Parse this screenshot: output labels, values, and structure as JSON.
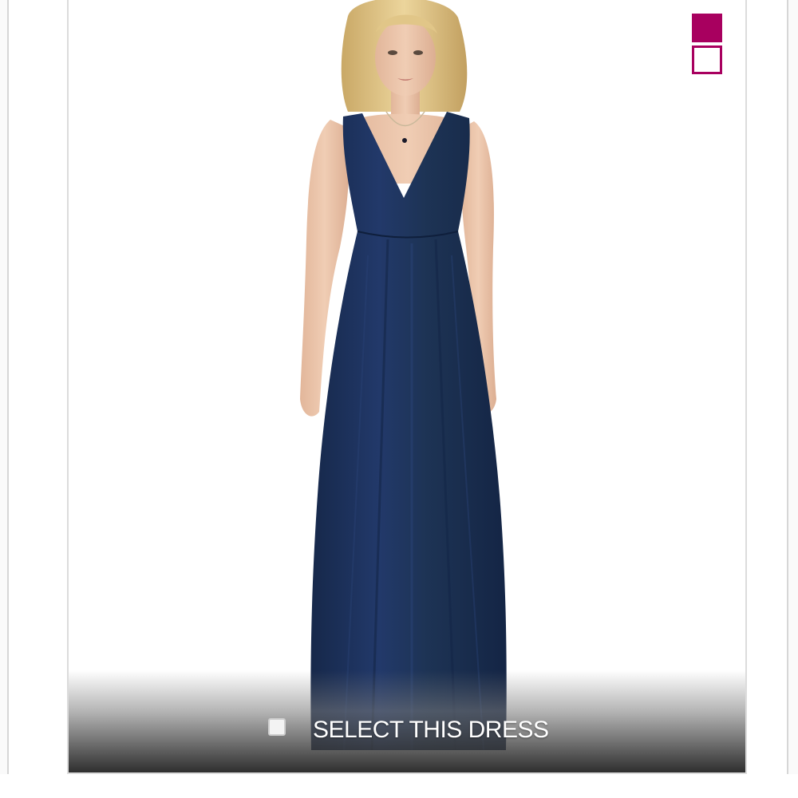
{
  "product": {
    "image": {
      "subject": "model wearing navy v-neck bridesmaid dress"
    },
    "dress_color": "#1d3354",
    "select_label": "SELECT THIS DRESS",
    "select_checked": false
  },
  "swatches": [
    {
      "name": "swatch-filled",
      "color": "#a8005f",
      "selected": true
    },
    {
      "name": "swatch-outline",
      "color": "#a8005f",
      "selected": false
    }
  ],
  "colors": {
    "accent": "#a8005f",
    "navy": "#1d3354"
  }
}
